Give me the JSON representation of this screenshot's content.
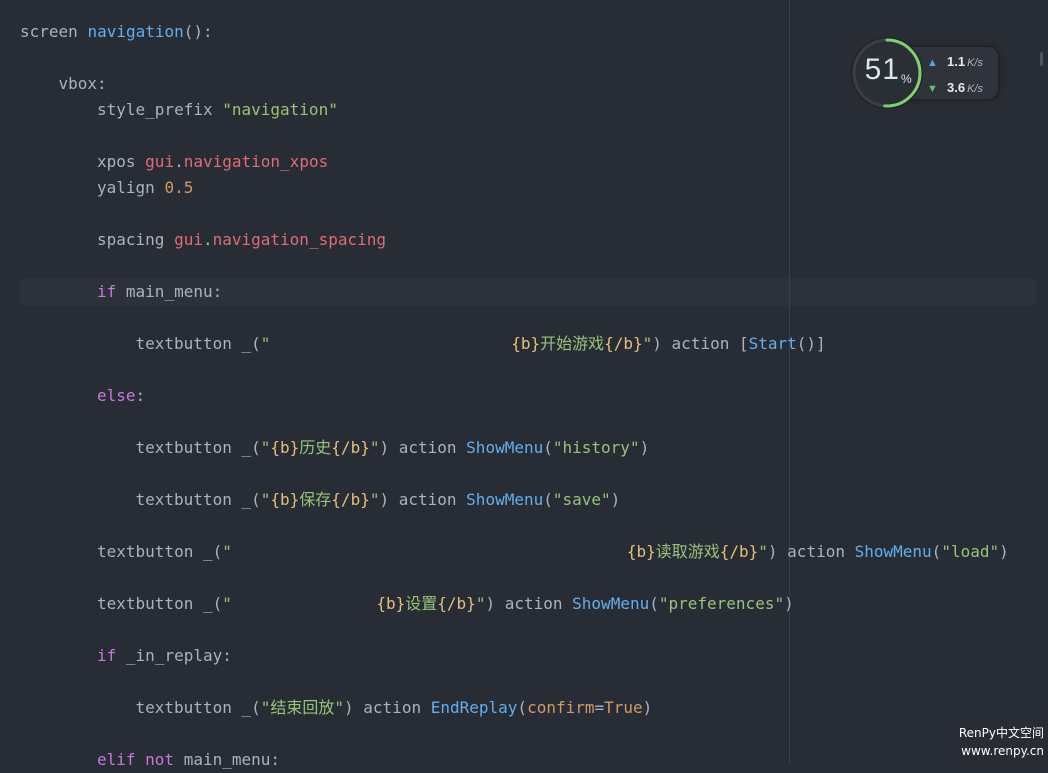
{
  "editor": {
    "lines": [
      {
        "indent": 0,
        "tokens": [
          {
            "t": "screen ",
            "c": "txt"
          },
          {
            "t": "navigation",
            "c": "fn"
          },
          {
            "t": "():",
            "c": "txt"
          }
        ]
      },
      {
        "indent": 0,
        "tokens": []
      },
      {
        "indent": 1,
        "tokens": [
          {
            "t": "vbox:",
            "c": "txt"
          }
        ]
      },
      {
        "indent": 2,
        "tokens": [
          {
            "t": "style_prefix ",
            "c": "txt"
          },
          {
            "t": "\"navigation\"",
            "c": "str"
          }
        ]
      },
      {
        "indent": 0,
        "tokens": []
      },
      {
        "indent": 2,
        "tokens": [
          {
            "t": "xpos ",
            "c": "txt"
          },
          {
            "t": "gui",
            "c": "var"
          },
          {
            "t": ".",
            "c": "txt"
          },
          {
            "t": "navigation_xpos",
            "c": "var"
          }
        ]
      },
      {
        "indent": 2,
        "tokens": [
          {
            "t": "yalign ",
            "c": "txt"
          },
          {
            "t": "0.5",
            "c": "num"
          }
        ]
      },
      {
        "indent": 0,
        "tokens": []
      },
      {
        "indent": 2,
        "tokens": [
          {
            "t": "spacing ",
            "c": "txt"
          },
          {
            "t": "gui",
            "c": "var"
          },
          {
            "t": ".",
            "c": "txt"
          },
          {
            "t": "navigation_spacing",
            "c": "var"
          }
        ]
      },
      {
        "indent": 0,
        "tokens": []
      },
      {
        "indent": 2,
        "tokens": [
          {
            "t": "if ",
            "c": "kw"
          },
          {
            "t": "main_menu:",
            "c": "txt"
          }
        ]
      },
      {
        "indent": 0,
        "tokens": []
      },
      {
        "indent": 3,
        "tokens": [
          {
            "t": "textbutton _(",
            "c": "txt"
          },
          {
            "t": "\"                         ",
            "c": "str"
          },
          {
            "t": "{b}",
            "c": "brace"
          },
          {
            "t": "开始游戏",
            "c": "str"
          },
          {
            "t": "{/b}",
            "c": "brace"
          },
          {
            "t": "\"",
            "c": "str"
          },
          {
            "t": ") action [",
            "c": "txt"
          },
          {
            "t": "Start",
            "c": "fn"
          },
          {
            "t": "()]",
            "c": "txt"
          }
        ]
      },
      {
        "indent": 0,
        "tokens": []
      },
      {
        "indent": 2,
        "tokens": [
          {
            "t": "else",
            "c": "kw"
          },
          {
            "t": ":",
            "c": "txt"
          }
        ]
      },
      {
        "indent": 0,
        "tokens": []
      },
      {
        "indent": 3,
        "tokens": [
          {
            "t": "textbutton _(",
            "c": "txt"
          },
          {
            "t": "\"",
            "c": "str"
          },
          {
            "t": "{b}",
            "c": "brace"
          },
          {
            "t": "历史",
            "c": "str"
          },
          {
            "t": "{/b}",
            "c": "brace"
          },
          {
            "t": "\"",
            "c": "str"
          },
          {
            "t": ") action ",
            "c": "txt"
          },
          {
            "t": "ShowMenu",
            "c": "fn"
          },
          {
            "t": "(",
            "c": "txt"
          },
          {
            "t": "\"history\"",
            "c": "str"
          },
          {
            "t": ")",
            "c": "txt"
          }
        ]
      },
      {
        "indent": 0,
        "tokens": []
      },
      {
        "indent": 3,
        "tokens": [
          {
            "t": "textbutton _(",
            "c": "txt"
          },
          {
            "t": "\"",
            "c": "str"
          },
          {
            "t": "{b}",
            "c": "brace"
          },
          {
            "t": "保存",
            "c": "str"
          },
          {
            "t": "{/b}",
            "c": "brace"
          },
          {
            "t": "\"",
            "c": "str"
          },
          {
            "t": ") action ",
            "c": "txt"
          },
          {
            "t": "ShowMenu",
            "c": "fn"
          },
          {
            "t": "(",
            "c": "txt"
          },
          {
            "t": "\"save\"",
            "c": "str"
          },
          {
            "t": ")",
            "c": "txt"
          }
        ]
      },
      {
        "indent": 0,
        "tokens": []
      },
      {
        "indent": 2,
        "tokens": [
          {
            "t": "textbutton _(",
            "c": "txt"
          },
          {
            "t": "\"                                         ",
            "c": "str"
          },
          {
            "t": "{b}",
            "c": "brace"
          },
          {
            "t": "读取游戏",
            "c": "str"
          },
          {
            "t": "{/b}",
            "c": "brace"
          },
          {
            "t": "\"",
            "c": "str"
          },
          {
            "t": ") action ",
            "c": "txt"
          },
          {
            "t": "ShowMenu",
            "c": "fn"
          },
          {
            "t": "(",
            "c": "txt"
          },
          {
            "t": "\"load\"",
            "c": "str"
          },
          {
            "t": ")",
            "c": "txt"
          }
        ]
      },
      {
        "indent": 0,
        "tokens": []
      },
      {
        "indent": 2,
        "tokens": [
          {
            "t": "textbutton _(",
            "c": "txt"
          },
          {
            "t": "\"               ",
            "c": "str"
          },
          {
            "t": "{b}",
            "c": "brace"
          },
          {
            "t": "设置",
            "c": "str"
          },
          {
            "t": "{/b}",
            "c": "brace"
          },
          {
            "t": "\"",
            "c": "str"
          },
          {
            "t": ") action ",
            "c": "txt"
          },
          {
            "t": "ShowMenu",
            "c": "fn"
          },
          {
            "t": "(",
            "c": "txt"
          },
          {
            "t": "\"preferences\"",
            "c": "str"
          },
          {
            "t": ")",
            "c": "txt"
          }
        ]
      },
      {
        "indent": 0,
        "tokens": []
      },
      {
        "indent": 2,
        "tokens": [
          {
            "t": "if ",
            "c": "kw"
          },
          {
            "t": "_in_replay:",
            "c": "txt"
          }
        ]
      },
      {
        "indent": 0,
        "tokens": []
      },
      {
        "indent": 3,
        "tokens": [
          {
            "t": "textbutton _(",
            "c": "txt"
          },
          {
            "t": "\"结束回放\"",
            "c": "str"
          },
          {
            "t": ") action ",
            "c": "txt"
          },
          {
            "t": "EndReplay",
            "c": "fn"
          },
          {
            "t": "(",
            "c": "txt"
          },
          {
            "t": "confirm",
            "c": "num"
          },
          {
            "t": "=",
            "c": "txt"
          },
          {
            "t": "True",
            "c": "num"
          },
          {
            "t": ")",
            "c": "txt"
          }
        ]
      },
      {
        "indent": 0,
        "tokens": []
      },
      {
        "indent": 2,
        "tokens": [
          {
            "t": "elif not ",
            "c": "kw"
          },
          {
            "t": "main_menu:",
            "c": "txt"
          }
        ]
      }
    ]
  },
  "net_monitor": {
    "percent": "51",
    "percent_unit": "%",
    "percent_fraction": 0.51,
    "upload_value": "1.1",
    "upload_unit": "K/s",
    "download_value": "3.6",
    "download_unit": "K/s",
    "upload_color": "#4ea7e6",
    "download_color": "#5cc46a",
    "ring_color": "#7fd16e"
  },
  "watermark": {
    "line1": "RenPy中文空间",
    "line2": "www.renpy.cn"
  }
}
